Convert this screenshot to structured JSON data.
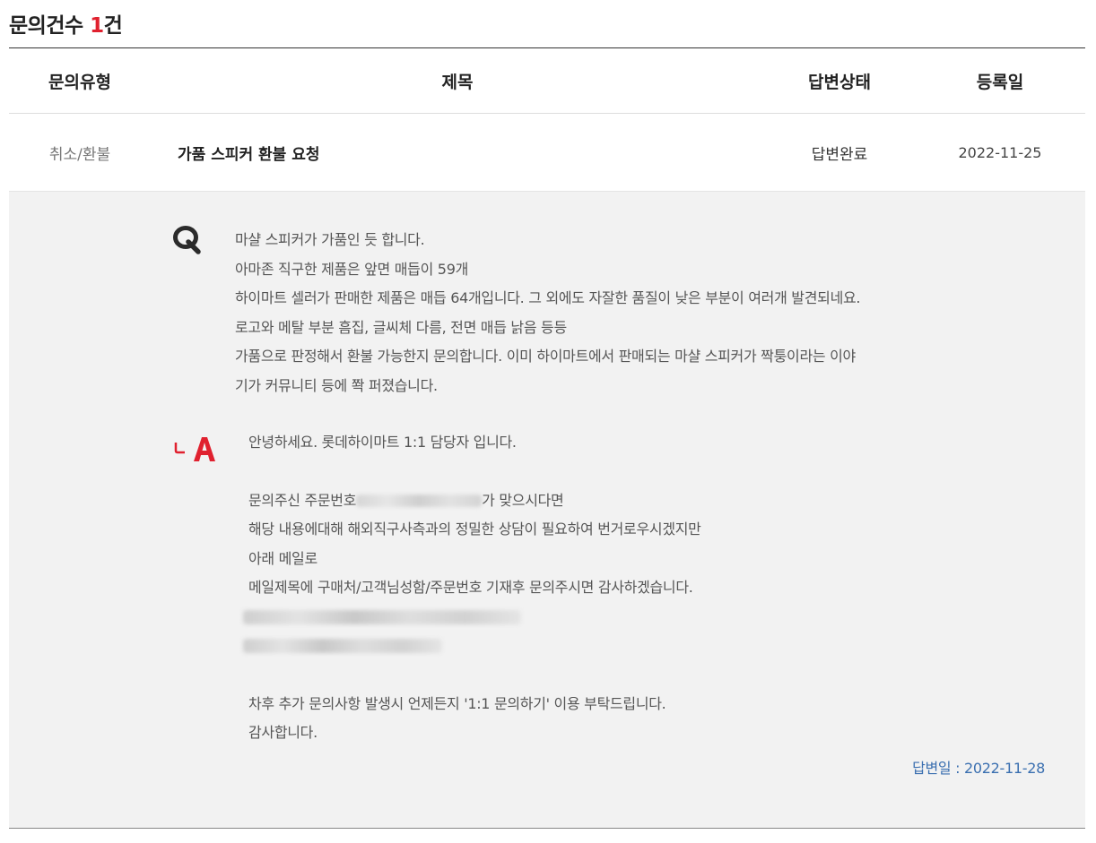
{
  "summary": {
    "label": "문의건수 ",
    "count": "1",
    "unit": "건"
  },
  "table": {
    "headers": {
      "type": "문의유형",
      "title": "제목",
      "status": "답변상태",
      "date": "등록일"
    },
    "row": {
      "type": "취소/환불",
      "title": "가품 스피커 환불 요청",
      "status": "답변완료",
      "date": "2022-11-25"
    }
  },
  "question": {
    "icon": "q-icon",
    "lines": [
      "마샬 스피커가 가품인 듯 합니다.",
      "아마존 직구한 제품은 앞면 매듭이 59개",
      "하이마트 셀러가 판매한 제품은 매듭 64개입니다. 그 외에도 자잘한 품질이 낮은 부분이 여러개 발견되네요.",
      "로고와 메탈 부분 흠집, 글씨체 다름, 전면 매듭 낡음 등등",
      "가품으로 판정해서 환불 가능한지 문의합니다. 이미 하이마트에서 판매되는 마샬 스피커가 짝퉁이라는 이야",
      "기가 커뮤니티 등에 쫙 퍼졌습니다."
    ]
  },
  "answer": {
    "icon": "a-icon",
    "greeting": "안녕하세요. 롯데하이마트 1:1 담당자 입니다.",
    "order_prefix": "문의주신 주문번호",
    "order_suffix": "가 맞으시다면",
    "line2": "해당 내용에대해 해외직구사측과의 정밀한 상담이 필요하여 번거로우시겠지만",
    "line3": "아래 메일로",
    "line4": "메일제목에 구매처/고객님성함/주문번호 기재후 문의주시면 감사하겠습니다.",
    "closing1": "차후 추가 문의사항 발생시 언제든지 '1:1 문의하기' 이용 부탁드립니다.",
    "closing2": "감사합니다.",
    "date_label": "답변일 : ",
    "date_value": "2022-11-28"
  },
  "colors": {
    "count_accent": "#e0212f",
    "answer_icon": "#e0212f",
    "answer_date": "#3a6fb0",
    "detail_bg": "#f2f2f2"
  }
}
